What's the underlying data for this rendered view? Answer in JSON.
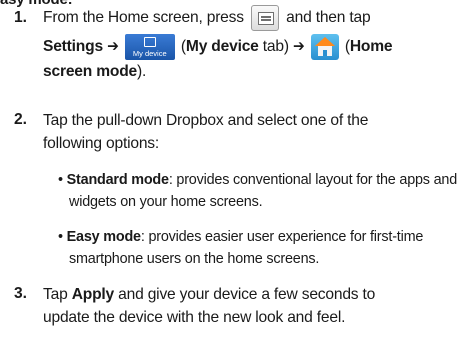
{
  "header": {
    "section_title_fragment": "asy mode:"
  },
  "steps": [
    {
      "number": "1.",
      "line1_pre": "From the Home screen, press",
      "line1_post": "and then tap",
      "line2_settings": "Settings",
      "line2_arrow1": "➔",
      "line2_tab_paren_open": "(",
      "line2_tab_name": "My device",
      "line2_tab_suffix": "tab)",
      "line2_arrow2": "➔",
      "line2_home_paren_open": "(",
      "line2_home_name": "Home",
      "line3_home_name_cont": "screen mode",
      "line3_close": ")."
    },
    {
      "number": "2.",
      "line1": "Tap the pull-down Dropbox and select one of the",
      "line2": "following options:"
    },
    {
      "number": "3.",
      "line1_pre": "Tap",
      "line1_apply": "Apply",
      "line1_post": "and give your device a few seconds to",
      "line2": "update the device with the new look and feel."
    }
  ],
  "options": [
    {
      "bullet": "•",
      "name": "Standard mode",
      "line1_rest": ": provides conventional layout for the apps and",
      "line2": "widgets on your home screens."
    },
    {
      "bullet": "•",
      "name": "Easy mode",
      "line1_rest": ": provides easier user experience for first-time",
      "line2": "smartphone users on the home screens."
    }
  ],
  "icons": {
    "menu_key": "menu-key-icon",
    "my_device_tab": "my-device-tab-icon",
    "my_device_tab_caption": "My device",
    "home_screen_mode": "home-screen-mode-icon"
  },
  "colors": {
    "text": "#1a1a1a",
    "tab_blue": "#1f5fb5",
    "home_blue": "#2a8fd0",
    "home_roof": "#ff8a1c"
  }
}
